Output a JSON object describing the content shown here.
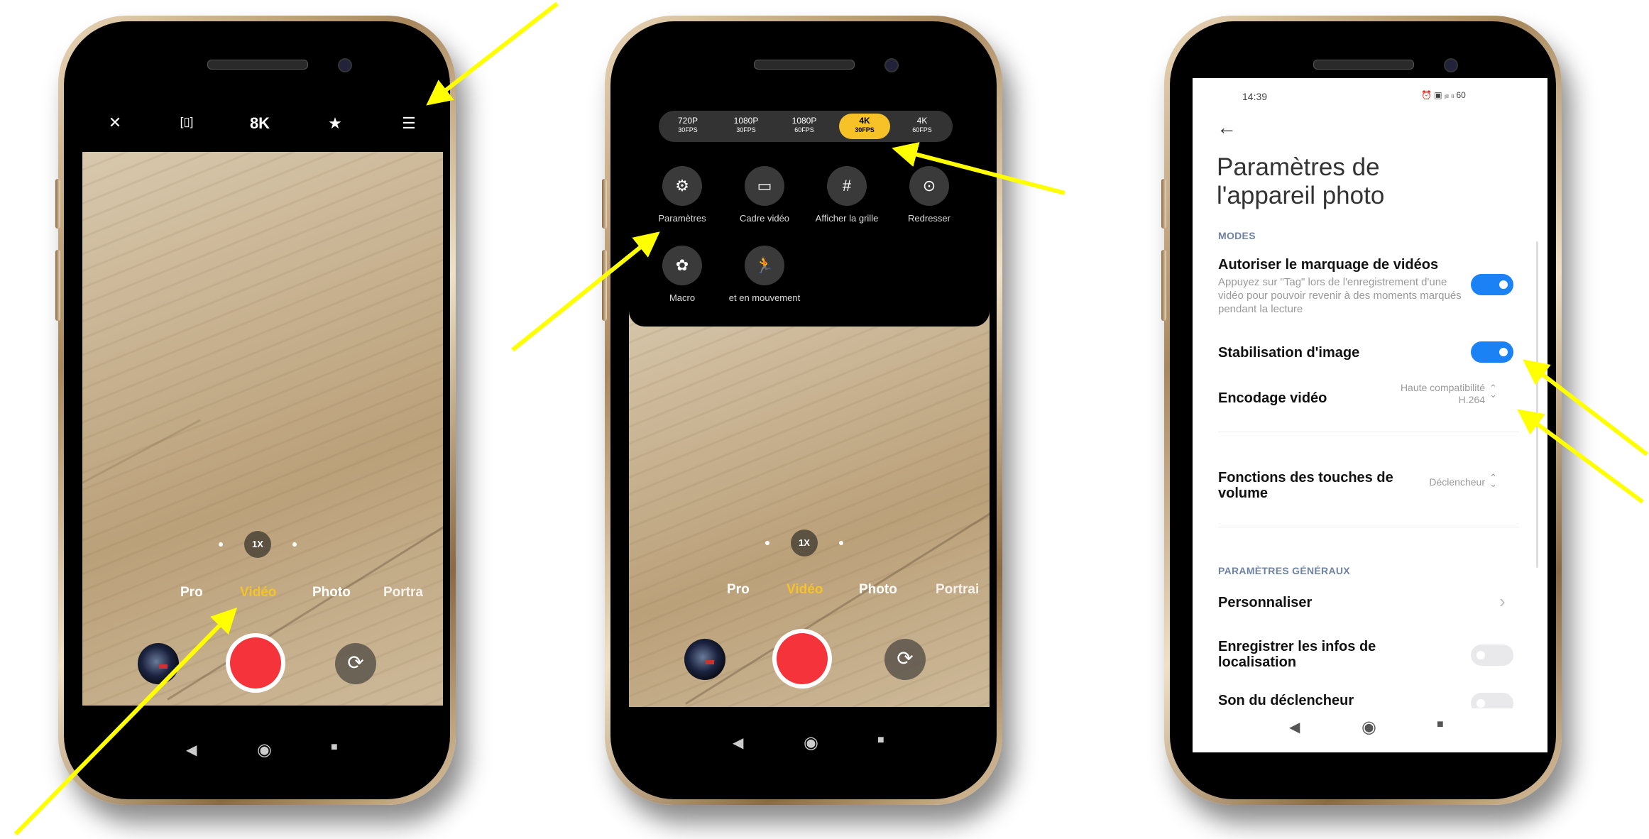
{
  "phone1": {
    "top_icons": {
      "flash_icon": "✕",
      "stabilize_icon": "[▯]",
      "resolution_label": "8K",
      "effects_icon": "★",
      "menu_icon": "☰"
    },
    "zoom_label": "1X",
    "modes": [
      "Pro",
      "Vidéo",
      "Photo",
      "Portra"
    ],
    "active_mode": "Vidéo"
  },
  "phone2": {
    "resolutions": [
      {
        "label": "720P",
        "sub": "30FPS"
      },
      {
        "label": "1080P",
        "sub": "30FPS"
      },
      {
        "label": "1080P",
        "sub": "60FPS"
      },
      {
        "label": "4K",
        "sub": "30FPS"
      },
      {
        "label": "4K",
        "sub": "60FPS"
      }
    ],
    "selected_resolution": "4K 30FPS",
    "options": [
      {
        "label": "Paramètres",
        "icon": "⚙"
      },
      {
        "label": "Cadre vidéo",
        "icon": "▭"
      },
      {
        "label": "Afficher la grille",
        "icon": "#"
      },
      {
        "label": "Redresser",
        "icon": "⊙"
      },
      {
        "label": "Macro",
        "icon": "✿"
      },
      {
        "label": "et en mouvement",
        "icon": "🏃"
      }
    ],
    "zoom_label": "1X",
    "modes": [
      "Pro",
      "Vidéo",
      "Photo",
      "Portrai"
    ],
    "active_mode": "Vidéo"
  },
  "phone3": {
    "status_time": "14:39",
    "status_icons": "⏰ ▣ ᵢₗₗ ₗₗ 60",
    "back_icon": "←",
    "title_line1": "Paramètres de",
    "title_line2": "l'appareil photo",
    "section_modes": "MODES",
    "item_tag_title": "Autoriser le marquage de vidéos",
    "item_tag_sub": "Appuyez sur \"Tag\" lors de l'enregistrement d'une vidéo pour pouvoir revenir à des moments marqués pendant la lecture",
    "item_stab_title": "Stabilisation d'image",
    "item_enc_title": "Encodage vidéo",
    "item_enc_value_line1": "Haute compatibilité",
    "item_enc_value_line2": "H.264",
    "item_vol_title": "Fonctions des touches de volume",
    "item_vol_value": "Déclencheur",
    "section_general": "PARAMÈTRES GÉNÉRAUX",
    "item_custom_title": "Personnaliser",
    "item_loc_title": "Enregistrer les infos de localisation",
    "item_sound_title": "Son du déclencheur",
    "chevron_right": "›",
    "updown": "⌃⌄"
  },
  "nav": {
    "back": "◀",
    "home": "◉",
    "recents": "■"
  },
  "colors": {
    "accent_yellow": "#f6c227",
    "toggle_blue": "#1a82f5",
    "record_red": "#f4343a",
    "annotation_yellow": "#ffff00"
  }
}
